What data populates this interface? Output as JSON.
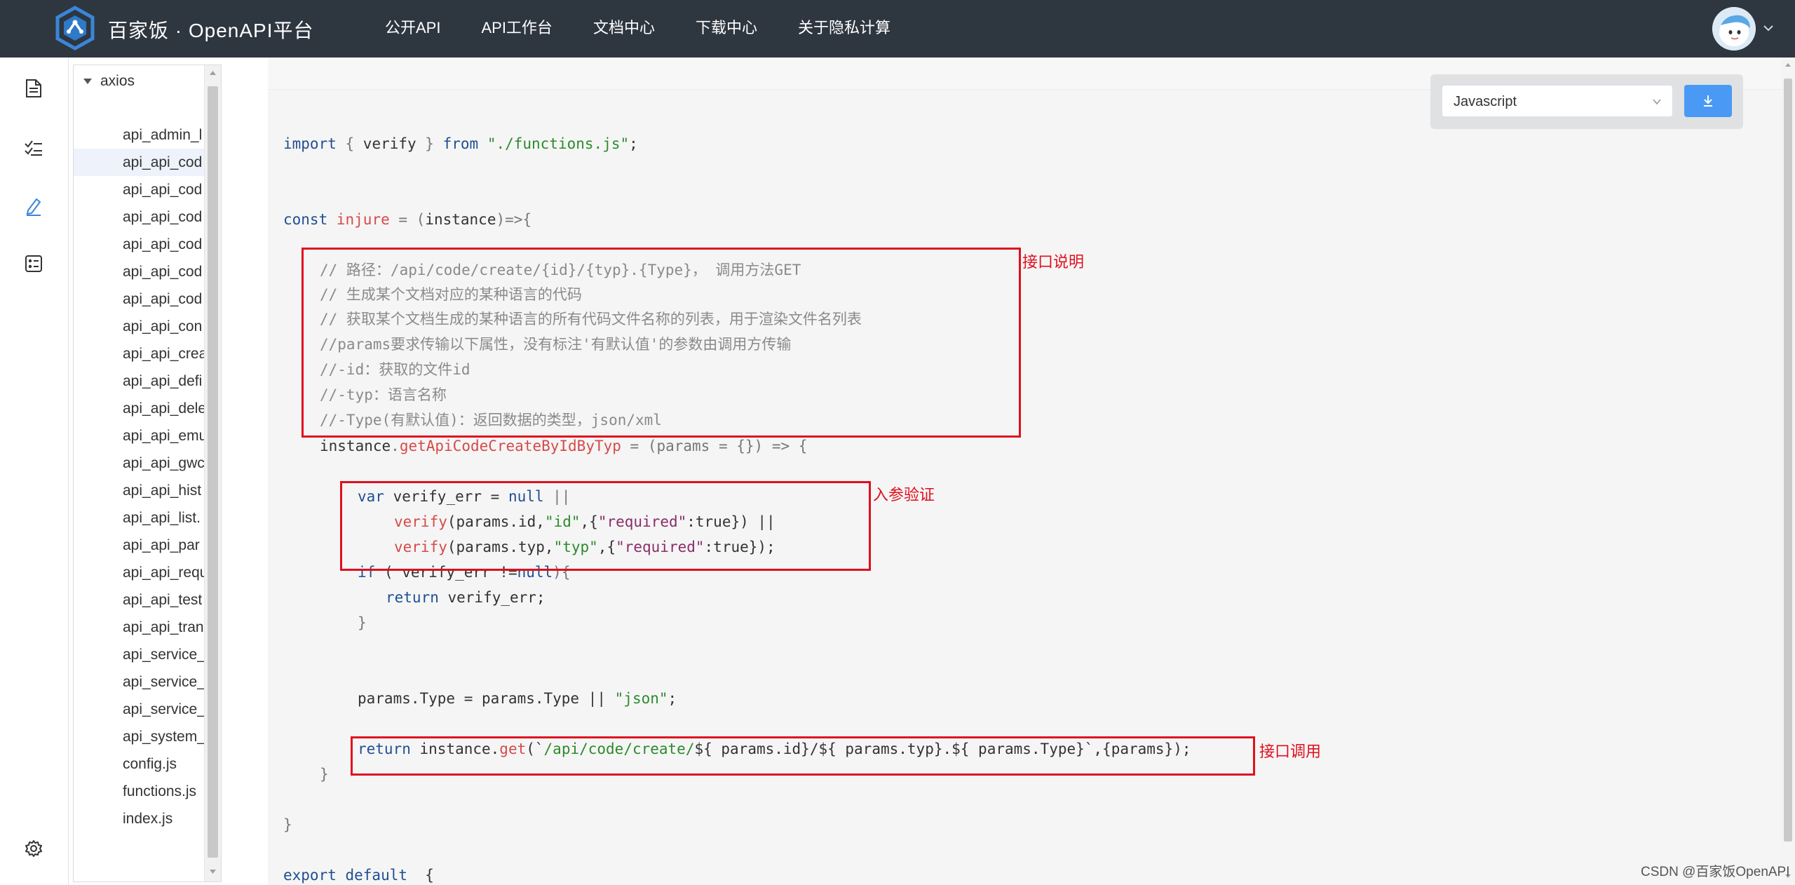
{
  "header": {
    "brand": "百家饭 · OpenAPI平台",
    "nav": [
      "公开API",
      "API工作台",
      "文档中心",
      "下载中心",
      "关于隐私计算"
    ]
  },
  "rail": {
    "icons": [
      "document-icon",
      "checklist-icon",
      "edit-pen-icon",
      "card-list-icon",
      "settings-gear-icon"
    ]
  },
  "tree": {
    "root": "axios",
    "items": [
      "api_admin_l",
      "api_api_cod",
      "api_api_cod",
      "api_api_cod",
      "api_api_cod",
      "api_api_cod",
      "api_api_cod",
      "api_api_con",
      "api_api_crea",
      "api_api_defi",
      "api_api_dele",
      "api_api_emu",
      "api_api_gwc",
      "api_api_hist",
      "api_api_list.",
      "api_api_par",
      "api_api_requ",
      "api_api_test",
      "api_api_tran",
      "api_service_",
      "api_service_",
      "api_service_",
      "api_system_",
      "config.js",
      "functions.js",
      "index.js"
    ],
    "active_index": 1
  },
  "toolbar": {
    "language": "Javascript"
  },
  "code": {
    "import": {
      "kw1": "import",
      "p1": " { ",
      "name": "verify",
      "p2": " } ",
      "kw2": "from",
      "sp": " ",
      "path": "\"./functions.js\"",
      "end": ";"
    },
    "const": {
      "kw": "const",
      "sp": " ",
      "name": "injure",
      "p1": " = (",
      "arg": "instance",
      "p2": ")=>{"
    },
    "comments": [
      "// 路径：/api/code/create/{id}/{typ}.{Type}， 调用方法GET",
      "// 生成某个文档对应的某种语言的代码",
      "// 获取某个文档生成的某种语言的所有代码文件名称的列表，用于渲染文件名列表",
      "//params要求传输以下属性，没有标注'有默认值'的参数由调用方传输",
      "//-id：获取的文件id",
      "//-typ：语言名称",
      "//-Type(有默认值)：返回数据的类型，json/xml"
    ],
    "method": {
      "obj": "instance",
      "dot": ".",
      "fn": "getApiCodeCreateByIdByTyp",
      "rest": " = (params = {}) => {"
    },
    "verify1": {
      "kw": "var",
      "rest1": " verify_err = ",
      "kw2": "null",
      "rest2": " ||"
    },
    "verify2": {
      "fn": "verify",
      "a": "(params.id,",
      "s": "\"id\"",
      "b": ",{",
      "k": "\"required\"",
      "c": ":true}) ||"
    },
    "verify3": {
      "fn": "verify",
      "a": "(params.typ,",
      "s": "\"typ\"",
      "b": ",{",
      "k": "\"required\"",
      "c": ":true});"
    },
    "if_line": {
      "kw": "if",
      "rest1": " ( verify_err !=",
      "kw2": "null",
      "rest2": "){"
    },
    "return_err": {
      "kw": "return",
      "rest": " verify_err;"
    },
    "close_brace": "}",
    "params_line": {
      "a": "params.Type = params.Type || ",
      "s": "\"json\"",
      "b": ";"
    },
    "return_get": {
      "kw": "return",
      "a": " instance.",
      "fn": "get",
      "b": "(`",
      "path": "/api/code/create/",
      "c": "${ params.id}/${ params.typ}.${ params.Type}`,{params});"
    },
    "close_inner": "}",
    "close_outer": "}",
    "export": {
      "kw": "export default",
      "rest": "  {"
    }
  },
  "annotations": {
    "doc": "接口说明",
    "verify": "入参验证",
    "call": "接口调用"
  },
  "watermark": "CSDN @百家饭OpenAPI"
}
